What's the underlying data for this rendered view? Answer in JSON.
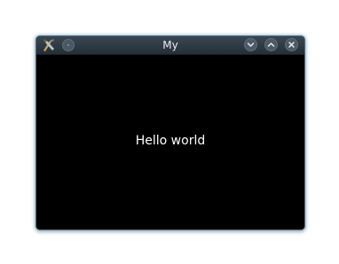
{
  "window": {
    "title": "My",
    "icons": {
      "app": "app-icon",
      "menu": "window-menu-icon",
      "minimize": "chevron-down-icon",
      "maximize": "chevron-up-icon",
      "close": "close-icon"
    },
    "colors": {
      "titlebar": "#2f3a44",
      "content_background": "#000000",
      "text": "#ffffff"
    }
  },
  "content": {
    "label": "Hello world"
  }
}
